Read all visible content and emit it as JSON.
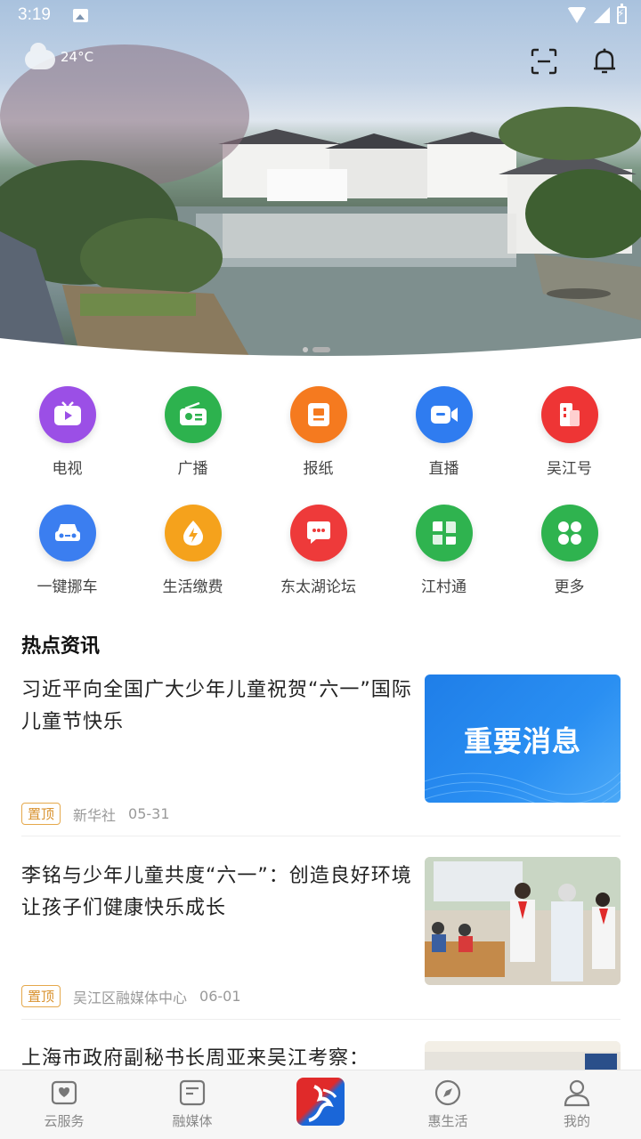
{
  "status_bar": {
    "time": "3:19"
  },
  "weather": {
    "temperature": "24°C",
    "icon": "cloud-icon"
  },
  "hero": {
    "banner_count": 2,
    "active_banner": 2
  },
  "services": [
    {
      "label": "电视",
      "icon": "tv-icon",
      "color": "#9b4fe6"
    },
    {
      "label": "广播",
      "icon": "radio-icon",
      "color": "#2db24e"
    },
    {
      "label": "报纸",
      "icon": "newspaper-icon",
      "color": "#f57a1f"
    },
    {
      "label": "直播",
      "icon": "live-camera-icon",
      "color": "#2f7cf0"
    },
    {
      "label": "吴江号",
      "icon": "wujiang-account-icon",
      "color": "#ee3535"
    },
    {
      "label": "一键挪车",
      "icon": "car-icon",
      "color": "#3b7ef0"
    },
    {
      "label": "生活缴费",
      "icon": "bill-payment-icon",
      "color": "#f5a21c"
    },
    {
      "label": "东太湖论坛",
      "icon": "forum-chat-icon",
      "color": "#ee3a3a"
    },
    {
      "label": "江村通",
      "icon": "village-icon",
      "color": "#2fb34f"
    },
    {
      "label": "更多",
      "icon": "more-apps-icon",
      "color": "#2fb34f"
    }
  ],
  "news_section": {
    "title": "热点资讯"
  },
  "news": [
    {
      "title": "习近平向全国广大少年儿童祝贺“六一”国际儿童节快乐",
      "badge": "置顶",
      "source": "新华社",
      "date": "05-31",
      "thumb_text": "重要消息"
    },
    {
      "title": "李铭与少年儿童共度“六一”：创造良好环境让孩子们健康快乐成长",
      "badge": "置顶",
      "source": "吴江区融媒体中心",
      "date": "06-01"
    },
    {
      "title": "上海市政府副秘书长周亚来吴江考察："
    }
  ],
  "bottom_nav": [
    {
      "label": "云服务",
      "icon": "cloud-service-icon"
    },
    {
      "label": "融媒体",
      "icon": "media-icon"
    },
    {
      "label": "",
      "icon": "app-logo-icon"
    },
    {
      "label": "惠生活",
      "icon": "compass-icon"
    },
    {
      "label": "我的",
      "icon": "profile-icon"
    }
  ]
}
